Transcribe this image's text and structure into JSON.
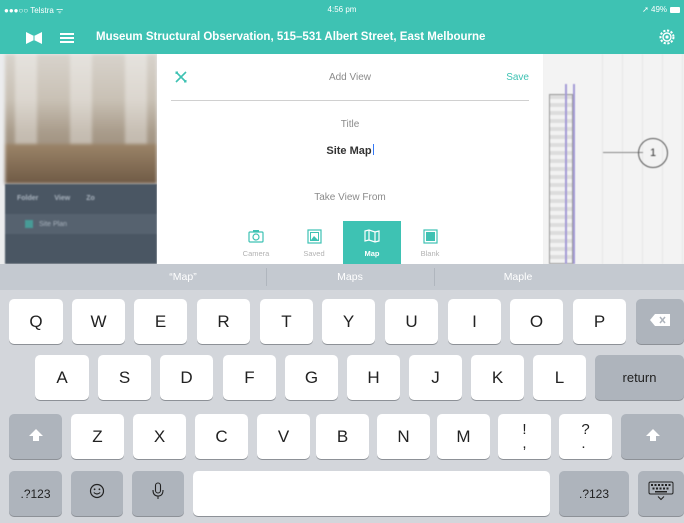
{
  "status": {
    "carrier": "●●●○○ Telstra ᯤ",
    "time": "4:56 pm",
    "battery": "➚ 49%"
  },
  "header": {
    "title": "Museum Structural Observation, 515–531 Albert Street, East Melbourne"
  },
  "background": {
    "folder_header": [
      "Folder",
      "View",
      "Zo"
    ],
    "folder_row": "Site Plan",
    "plan_marker": "1"
  },
  "modal": {
    "title": "Add View",
    "save_label": "Save",
    "title_label": "Title",
    "title_value": "Site Map",
    "take_from_label": "Take View From",
    "sources": [
      {
        "label": "Camera",
        "icon": "camera-icon",
        "active": false
      },
      {
        "label": "Saved",
        "icon": "saved-image-icon",
        "active": false
      },
      {
        "label": "Map",
        "icon": "map-icon",
        "active": true
      },
      {
        "label": "Blank",
        "icon": "blank-page-icon",
        "active": false
      }
    ]
  },
  "keyboard": {
    "suggestions": [
      "“Map”",
      "Maps",
      "Maple"
    ],
    "row1": [
      "Q",
      "W",
      "E",
      "R",
      "T",
      "Y",
      "U",
      "I",
      "O",
      "P"
    ],
    "row2": [
      "A",
      "S",
      "D",
      "F",
      "G",
      "H",
      "J",
      "K",
      "L"
    ],
    "row3": [
      "Z",
      "X",
      "C",
      "V",
      "B",
      "N",
      "M",
      "!\n,",
      "?\n."
    ],
    "return_label": "return",
    "numbers_label": ".?123"
  },
  "colors": {
    "accent": "#3ec2b3"
  }
}
